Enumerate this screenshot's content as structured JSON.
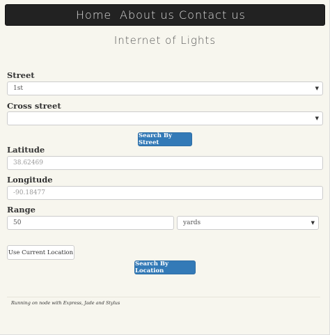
{
  "nav": {
    "items": [
      "Home",
      "About us",
      "Contact us"
    ]
  },
  "page": {
    "title": "Internet of Lights"
  },
  "form": {
    "street": {
      "label": "Street",
      "value": "1st"
    },
    "cross_street": {
      "label": "Cross street",
      "value": ""
    },
    "search_street_button": "Search By Street",
    "latitude": {
      "label": "Latitude",
      "value": "38.62469"
    },
    "longitude": {
      "label": "Longitude",
      "value": "-90.18477"
    },
    "range": {
      "label": "Range",
      "value": "50",
      "unit": "yards"
    },
    "use_location_button": "Use Current Location",
    "search_location_button": "Search By Location"
  },
  "footer": {
    "text": "Running on node with Express, Jade and Stylus"
  },
  "icons": {
    "select_caret": "caret-down-icon"
  }
}
